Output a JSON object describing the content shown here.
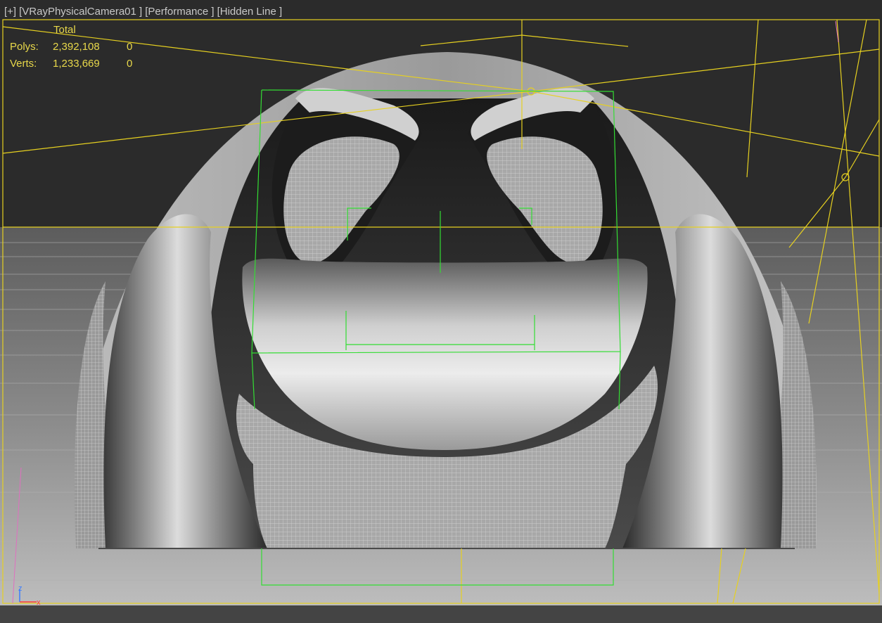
{
  "viewport": {
    "menu": {
      "plus_label": "[+]",
      "camera_label": "[VRayPhysicalCamera01 ]",
      "shading_label": "[Performance ]",
      "style_label": "[Hidden Line ]"
    },
    "stats": {
      "column_title": "Total",
      "polys_label": "Polys:",
      "polys_total": "2,392,108",
      "polys_selected": "0",
      "verts_label": "Verts:",
      "verts_total": "1,233,669",
      "verts_selected": "0"
    },
    "axis": {
      "z_label": "z",
      "x_label": "x"
    }
  },
  "colors": {
    "viewport_bg": "#2b2b2b",
    "safe_frame": "#e6d020",
    "selection_green": "#33dd33",
    "stats_text": "#e8d84a",
    "header_text": "#c8c8c8"
  }
}
